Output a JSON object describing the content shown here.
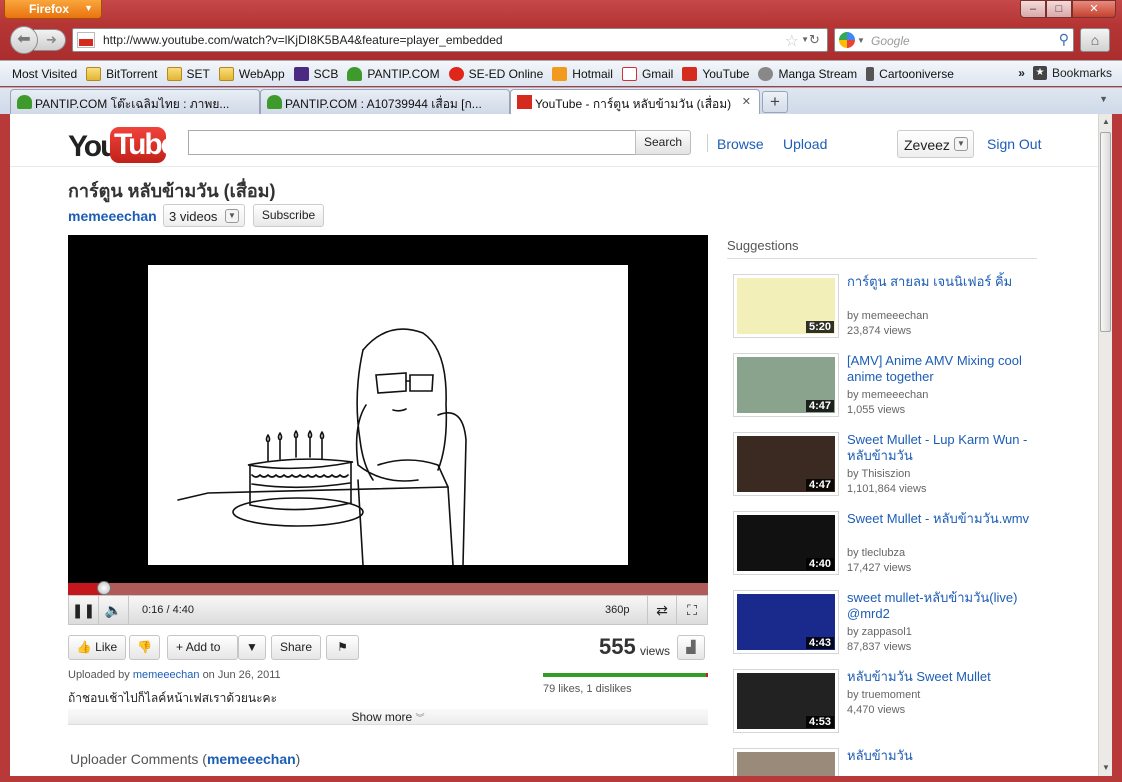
{
  "browser": {
    "menu_button": "Firefox",
    "url": "http://www.youtube.com/watch?v=lKjDI8K5BA4&feature=player_embedded",
    "search_placeholder": "Google",
    "window_controls": {
      "minimize": "–",
      "maximize": "□",
      "close": "✕"
    },
    "bookmarks": [
      {
        "label": "Most Visited",
        "icon": "page-icon"
      },
      {
        "label": "BitTorrent",
        "icon": "folder-icon"
      },
      {
        "label": "SET",
        "icon": "folder-icon"
      },
      {
        "label": "WebApp",
        "icon": "folder-icon"
      },
      {
        "label": "SCB",
        "icon": "scb-icon"
      },
      {
        "label": "PANTIP.COM",
        "icon": "cactus-icon"
      },
      {
        "label": "SE-ED Online",
        "icon": "seed-icon"
      },
      {
        "label": "Hotmail",
        "icon": "hotmail-icon"
      },
      {
        "label": "Gmail",
        "icon": "gmail-icon"
      },
      {
        "label": "YouTube",
        "icon": "youtube-icon"
      },
      {
        "label": "Manga Stream",
        "icon": "manga-icon"
      },
      {
        "label": "Cartooniverse",
        "icon": "cartoon-icon"
      }
    ],
    "bookmarks_overflow": "»",
    "bookmarks_menu": "Bookmarks",
    "tabs": [
      {
        "label": "PANTIP.COM โต๊ะเฉลิมไทย : ภาพย...",
        "active": false
      },
      {
        "label": "PANTIP.COM : A10739944 เสื่อม [ก...",
        "active": false
      },
      {
        "label": "YouTube - การ์ตูน หลับข้ามวัน (เสื่อม)",
        "active": true
      }
    ]
  },
  "youtube": {
    "header": {
      "logo_you": "You",
      "logo_tube": "Tube",
      "search_button": "Search",
      "browse": "Browse",
      "upload": "Upload",
      "username": "Zeveez",
      "sign_out": "Sign Out"
    },
    "video": {
      "title": "การ์ตูน หลับข้ามวัน (เสื่อม)",
      "channel": "memeeechan",
      "videos_count": "3 videos",
      "subscribe": "Subscribe",
      "time": "0:16 / 4:40",
      "progress_fraction": 0.057,
      "quality": "360p",
      "like": "Like",
      "add_to": "Add to",
      "share": "Share",
      "views_count": "555",
      "views_label": "views",
      "uploaded_prefix": "Uploaded by",
      "uploaded_by": "memeeechan",
      "uploaded_date": "on Jun 26, 2011",
      "description": "ถ้าชอบเช้าไปก็ไลค์หน้าเฟสเราด้วยนะคะ",
      "likes_text": "79 likes, 1 dislikes",
      "like_fraction": 0.987,
      "show_more": "Show more",
      "uploader_comments_label": "Uploader Comments (",
      "uploader_comments_name": "memeeechan",
      "uploader_comments_close": ")"
    },
    "suggestions_title": "Suggestions",
    "suggestions": [
      {
        "title": "การ์ตูน สายลม เจนนิเฟอร์ คิ้ม",
        "by": "by memeeechan",
        "views": "23,874 views",
        "duration": "5:20",
        "thumb_color": "#f2efb8"
      },
      {
        "title": "[AMV] Anime AMV Mixing cool anime together",
        "by": "by memeeechan",
        "views": "1,055 views",
        "duration": "4:47",
        "thumb_color": "#8aa38c"
      },
      {
        "title": "Sweet Mullet - Lup Karm Wun - หลับข้ามวัน",
        "by": "by Thisiszion",
        "views": "1,101,864 views",
        "duration": "4:47",
        "thumb_color": "#3a2a22"
      },
      {
        "title": "Sweet Mullet - หลับข้ามวัน.wmv",
        "by": "by tleclubza",
        "views": "17,427 views",
        "duration": "4:40",
        "thumb_color": "#111111"
      },
      {
        "title": "sweet mullet-หลับข้ามวัน(live) @mrd2",
        "by": "by zappasol1",
        "views": "87,837 views",
        "duration": "4:43",
        "thumb_color": "#1a2a8c"
      },
      {
        "title": "หลับข้ามวัน Sweet Mullet",
        "by": "by truemoment",
        "views": "4,470 views",
        "duration": "4:53",
        "thumb_color": "#222222"
      },
      {
        "title": "หลับข้ามวัน",
        "by": "",
        "views": "",
        "duration": "",
        "thumb_color": "#9a8a7a"
      }
    ]
  }
}
